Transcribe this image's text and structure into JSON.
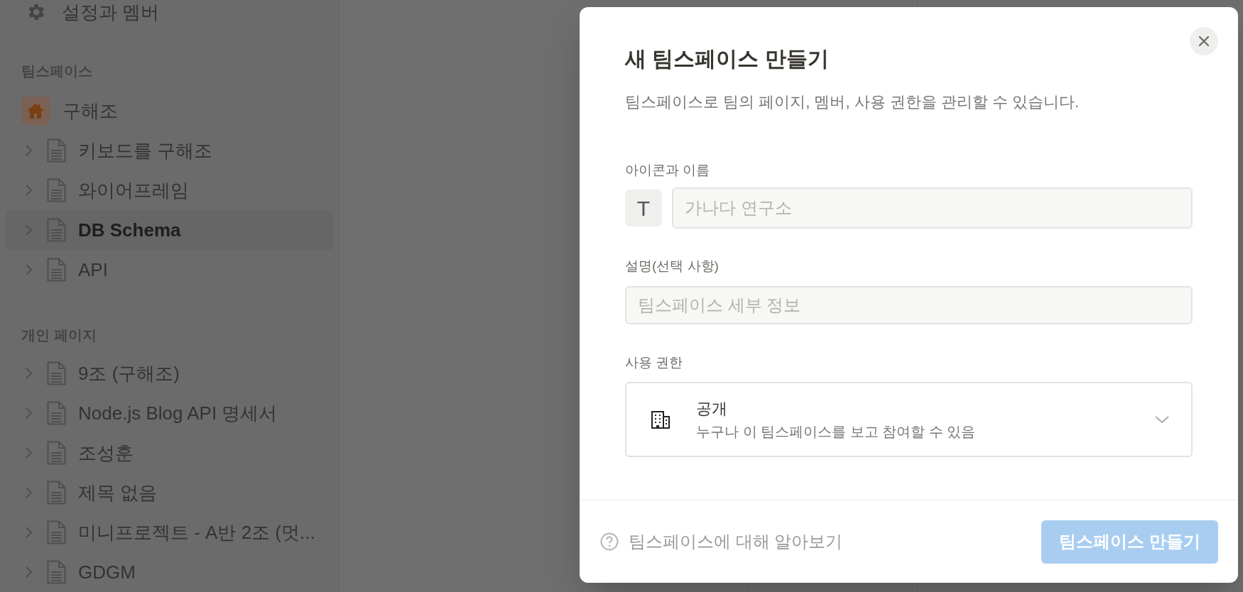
{
  "sidebar": {
    "top_item": {
      "label": "설정과 멤버"
    },
    "sections": [
      {
        "heading": "팀스페이스",
        "workspace": {
          "label": "구해조"
        },
        "items": [
          {
            "label": "키보드를 구해조",
            "selected": false
          },
          {
            "label": "와이어프레임",
            "selected": false
          },
          {
            "label": "DB Schema",
            "selected": true
          },
          {
            "label": "API",
            "selected": false
          }
        ]
      },
      {
        "heading": "개인 페이지",
        "items": [
          {
            "label": "9조 (구해조)",
            "selected": false
          },
          {
            "label": "Node.js Blog API 명세서",
            "selected": false
          },
          {
            "label": "조성훈",
            "selected": false
          },
          {
            "label": "제목 없음",
            "selected": false
          },
          {
            "label": "미니프로젝트 - A반 2조 (멋...",
            "selected": false
          },
          {
            "label": "GDGM",
            "selected": false
          }
        ]
      }
    ]
  },
  "modal": {
    "title": "새 팀스페이스 만들기",
    "description": "팀스페이스로 팀의 페이지, 멤버, 사용 권한을 관리할 수 있습니다.",
    "name_field": {
      "label": "아이콘과 이름",
      "icon_letter": "T",
      "placeholder": "가나다 연구소"
    },
    "description_field": {
      "label": "설명(선택 사항)",
      "placeholder": "팀스페이스 세부 정보"
    },
    "permission": {
      "label": "사용 권한",
      "value": "공개",
      "detail": "누구나 이 팀스페이스를 보고 참여할 수 있음"
    },
    "help_link": "팀스페이스에 대해 알아보기",
    "create_button": {
      "label": "팀스페이스 만들기",
      "disabled": true
    }
  }
}
